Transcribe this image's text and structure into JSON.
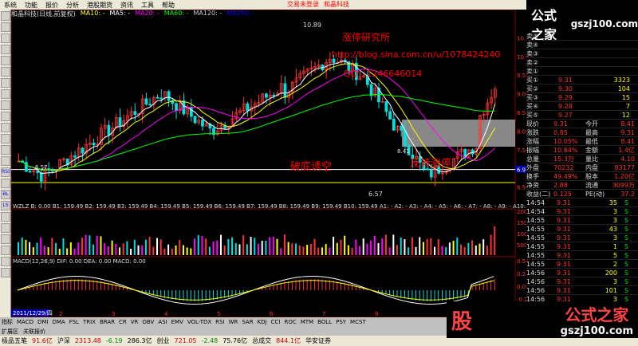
{
  "menu": [
    "系统",
    "功能",
    "报价",
    "分析",
    "港股期货",
    "资讯",
    "工具",
    "帮助"
  ],
  "menu_right": [
    "交易未登录",
    "和晶科技"
  ],
  "toolbar_icons": [
    "RSI",
    "BL",
    "LS"
  ],
  "ticker": {
    "name": "和晶科技(日线,前复权)",
    "ma_labels": [
      "MA10: -",
      "MA5: -",
      "MA20: -",
      "MA60: -",
      "MA120: -",
      "MA250: -"
    ]
  },
  "annotations": {
    "title": "涨停研究所",
    "url": "http://blog.sina.com.cn/u/1078424240",
    "qq": "QQ：1246646014",
    "label_break": "破底诱空",
    "label_rise": "反转涨停",
    "peak_label": "10.89",
    "low_label": "6.57",
    "left_low": "6.57",
    "mid_label": "8.41"
  },
  "price_axis": [
    "10.50",
    "10.00",
    "9.50",
    "9.00",
    "8.50",
    "8.00",
    "7.50",
    "7.00",
    "6.97",
    "6.50"
  ],
  "vol_row": "WZLZ B: 0.00 B1: 159.49 B2: 159.49 B3: 159.49 B4: 159.49 B5: 159.49 B6: 159.49 B7: 159.49 B8: 159.49 B9: 159.49 B10: 159.49 A1: - A2: - A3: - A4: - A5: - A6: - A7: - A8: - A9: - A10: - WOL:",
  "vol_axis": [
    "20000",
    "15000",
    "10000",
    "5000"
  ],
  "macd_row": "MACD(12,26,9) DIF: 0.00 DEA: 0.00 MACD: 0.00",
  "macd_axis": [
    "0.50",
    "0.25",
    "0.00",
    "-0.25",
    "-0.50"
  ],
  "date_label": "2011/12/29/四",
  "x_ticks": [
    "2",
    "3",
    "4",
    "5",
    "6",
    "7",
    "8"
  ],
  "quote_rows": [
    {
      "l": "卖⑤",
      "p": "",
      "v": ""
    },
    {
      "l": "卖④",
      "p": "",
      "v": ""
    },
    {
      "l": "卖③",
      "p": "",
      "v": ""
    },
    {
      "l": "卖②",
      "p": "",
      "v": ""
    },
    {
      "l": "卖①",
      "p": "",
      "v": ""
    },
    {
      "l": "买①",
      "p": "9.31",
      "v": "3323"
    },
    {
      "l": "买②",
      "p": "9.30",
      "v": "104"
    },
    {
      "l": "买③",
      "p": "9.29",
      "v": "15"
    },
    {
      "l": "买④",
      "p": "9.28",
      "v": "7"
    },
    {
      "l": "买⑤",
      "p": "9.27",
      "v": "12"
    }
  ],
  "stats": [
    {
      "a": "现价",
      "b": "9.31",
      "c": "今开",
      "d": "8.41"
    },
    {
      "a": "涨跌",
      "b": "0.85",
      "c": "最高",
      "d": "9.31"
    },
    {
      "a": "涨幅",
      "b": "10.05%",
      "c": "最低",
      "d": "8.41"
    },
    {
      "a": "振幅",
      "b": "10.64%",
      "c": "金额",
      "d": "1.4亿"
    },
    {
      "a": "总量",
      "b": "15.3万",
      "c": "量比",
      "d": "4.10"
    },
    {
      "a": "外盘",
      "b": "70232",
      "c": "内盘",
      "d": "83177"
    },
    {
      "a": "换手",
      "b": "49.49%",
      "c": "股本",
      "d": "1.20亿"
    },
    {
      "a": "净资",
      "b": "2.88",
      "c": "流通",
      "d": "3099万"
    },
    {
      "a": "收益(二)",
      "b": "0.125",
      "c": "PE(动)",
      "d": "37.2"
    }
  ],
  "ticks": [
    {
      "t": "14:54",
      "p": "9.31",
      "v": "35",
      "s": "S"
    },
    {
      "t": "14:54",
      "p": "9.31",
      "v": "3",
      "s": "S"
    },
    {
      "t": "14:55",
      "p": "9.31",
      "v": "3",
      "s": "S"
    },
    {
      "t": "14:55",
      "p": "9.31",
      "v": "43",
      "s": "S"
    },
    {
      "t": "14:55",
      "p": "9.31",
      "v": "3",
      "s": "S"
    },
    {
      "t": "14:55",
      "p": "9.31",
      "v": "1",
      "s": "S"
    },
    {
      "t": "14:55",
      "p": "9.31",
      "v": "5",
      "s": "S"
    },
    {
      "t": "14:55",
      "p": "9.31",
      "v": "2",
      "s": "S"
    },
    {
      "t": "14:56",
      "p": "9.31",
      "v": "200",
      "s": "S"
    },
    {
      "t": "14:56",
      "p": "9.31",
      "v": "3",
      "s": "S"
    },
    {
      "t": "14:56",
      "p": "9.31",
      "v": "101",
      "s": "S"
    },
    {
      "t": "14:56",
      "p": "9.31",
      "v": "3",
      "s": "S"
    },
    {
      "t": "14:56",
      "p": "9.31",
      "v": "5",
      "s": "S"
    }
  ],
  "bottom_tabs": [
    "指标",
    "MACD",
    "DMI",
    "DMA",
    "FSL",
    "TRIX",
    "BRAR",
    "CR",
    "VR",
    "OBV",
    "ASI",
    "EMV",
    "VOL-TDX",
    "RSI",
    "WR",
    "SAR",
    "KDJ",
    "CCI",
    "ROC",
    "MTM",
    "BOLL",
    "PSY",
    "MCST"
  ],
  "bottom_tabs2": [
    "扩展区",
    "关联报价"
  ],
  "status": [
    {
      "k": "沪深",
      "v": "2313.48",
      "d": "-6.19",
      "a": "286.3亿"
    },
    {
      "k": "创业",
      "v": "721.05",
      "d": "-2.48",
      "a": "75.76亿"
    },
    {
      "k": "总成交",
      "v": "844.1亿",
      "d": "",
      "a": ""
    }
  ],
  "status_left": "极品五笔",
  "status_left2": "91.6亿",
  "status_right": "华安证券",
  "watermark": {
    "cn": "公式之家",
    "site": "gszj100.com",
    "logo": "股"
  },
  "colors": {
    "up": "#ff3333",
    "down": "#00e0e0",
    "ma5": "#ffffff",
    "ma10": "#ffff00",
    "ma20": "#ff00ff",
    "ma60": "#00ff00"
  }
}
